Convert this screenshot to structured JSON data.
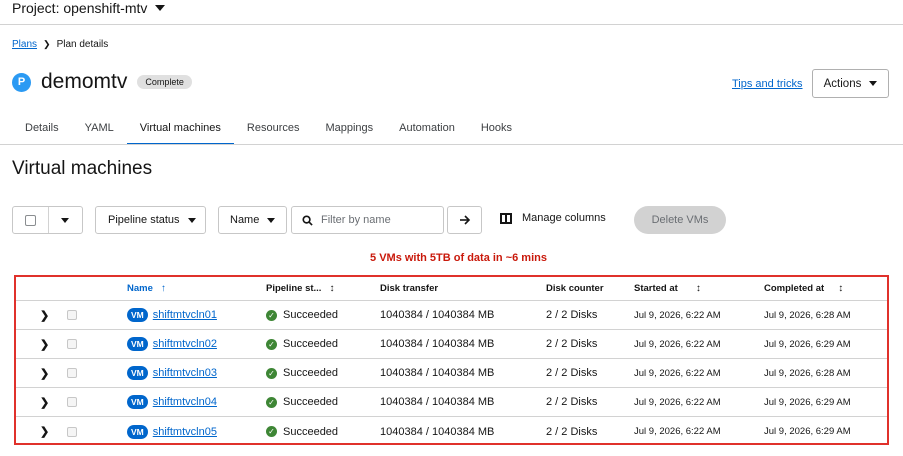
{
  "project": {
    "label": "Project: openshift-mtv"
  },
  "breadcrumb": {
    "parent": "Plans",
    "current": "Plan details"
  },
  "header": {
    "badge": "P",
    "title": "demomtv",
    "status": "Complete",
    "tips_link": "Tips and tricks",
    "actions_label": "Actions"
  },
  "tabs": [
    {
      "label": "Details"
    },
    {
      "label": "YAML"
    },
    {
      "label": "Virtual machines",
      "active": true
    },
    {
      "label": "Resources"
    },
    {
      "label": "Mappings"
    },
    {
      "label": "Automation"
    },
    {
      "label": "Hooks"
    }
  ],
  "section_title": "Virtual machines",
  "toolbar": {
    "pipeline_filter": "Pipeline status",
    "name_filter": "Name",
    "search_placeholder": "Filter by name",
    "manage_columns": "Manage columns",
    "delete_vms": "Delete VMs"
  },
  "annotation": "5 VMs with 5TB of data in ~6 mins",
  "table": {
    "headers": {
      "name": "Name",
      "pipeline_status": "Pipeline st...",
      "disk_transfer": "Disk transfer",
      "disk_counter": "Disk counter",
      "started_at": "Started at",
      "completed_at": "Completed at"
    },
    "vm_badge": "VM",
    "rows": [
      {
        "name": "shiftmtvcln01",
        "status": "Succeeded",
        "disk_transfer": "1040384 / 1040384 MB",
        "disk_counter": "2 / 2 Disks",
        "started_at": "Jul 9, 2026, 6:22 AM",
        "completed_at": "Jul 9, 2026, 6:28 AM"
      },
      {
        "name": "shiftmtvcln02",
        "status": "Succeeded",
        "disk_transfer": "1040384 / 1040384 MB",
        "disk_counter": "2 / 2 Disks",
        "started_at": "Jul 9, 2026, 6:22 AM",
        "completed_at": "Jul 9, 2026, 6:29 AM"
      },
      {
        "name": "shiftmtvcln03",
        "status": "Succeeded",
        "disk_transfer": "1040384 / 1040384 MB",
        "disk_counter": "2 / 2 Disks",
        "started_at": "Jul 9, 2026, 6:22 AM",
        "completed_at": "Jul 9, 2026, 6:28 AM"
      },
      {
        "name": "shiftmtvcln04",
        "status": "Succeeded",
        "disk_transfer": "1040384 / 1040384 MB",
        "disk_counter": "2 / 2 Disks",
        "started_at": "Jul 9, 2026, 6:22 AM",
        "completed_at": "Jul 9, 2026, 6:29 AM"
      },
      {
        "name": "shiftmtvcln05",
        "status": "Succeeded",
        "disk_transfer": "1040384 / 1040384 MB",
        "disk_counter": "2 / 2 Disks",
        "started_at": "Jul 9, 2026, 6:22 AM",
        "completed_at": "Jul 9, 2026, 6:29 AM"
      }
    ]
  },
  "colors": {
    "accent": "#0066cc",
    "success": "#3e8635",
    "highlight_border": "#e0312b",
    "annotation": "#c9190b"
  }
}
